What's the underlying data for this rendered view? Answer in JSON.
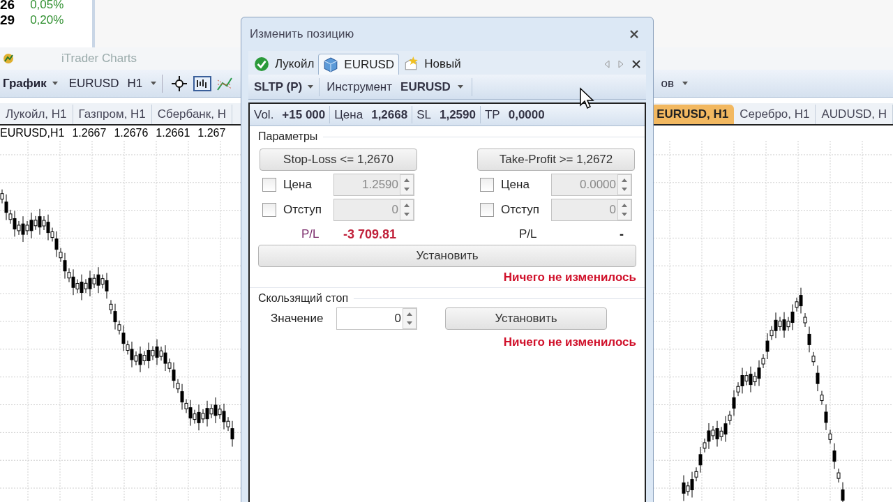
{
  "app": {
    "title": "iTrader Charts",
    "quotes": [
      {
        "price": "26",
        "change": "0,05%"
      },
      {
        "price": "29",
        "change": "0,20%"
      }
    ],
    "toolbar": {
      "chart_menu": "График",
      "symbol": "EURUSD",
      "timeframe": "H1",
      "overflow_label": "ов"
    },
    "chart_tabs_left": [
      {
        "label": "Лукойл, H1",
        "selected": false
      },
      {
        "label": "Газпром, H1",
        "selected": false
      },
      {
        "label": "Сбербанк, H",
        "selected": false
      }
    ],
    "chart_tabs_right": [
      {
        "label": "EURUSD, H1",
        "selected": true
      },
      {
        "label": "Серебро, H1",
        "selected": false
      },
      {
        "label": "AUDUSD, H",
        "selected": false
      }
    ],
    "chart_header": {
      "symbol": "EURUSD,H1",
      "values": [
        "1.2667",
        "1.2676",
        "1.2661",
        "1.267"
      ]
    }
  },
  "dialog": {
    "title": "Изменить позицию",
    "tabs": [
      {
        "label": "Лукойл",
        "selected": false
      },
      {
        "label": "EURUSD",
        "selected": true
      },
      {
        "label": "Новый",
        "selected": false
      }
    ],
    "toolbar": {
      "mode": "SLTP (P)",
      "instrument_label": "Инструмент",
      "instrument": "EURUSD"
    },
    "info": [
      {
        "label": "Vol.",
        "value": "+15 000"
      },
      {
        "label": "Цена",
        "value": "1,2668"
      },
      {
        "label": "SL",
        "value": "1,2590"
      },
      {
        "label": "TP",
        "value": "0,0000"
      }
    ],
    "params": {
      "title": "Параметры",
      "columns": [
        {
          "button": "Stop-Loss <= 1,2670",
          "rows": [
            {
              "label": "Цена",
              "checked": false,
              "value": "1.2590",
              "disabled": true
            },
            {
              "label": "Отступ",
              "checked": false,
              "value": "0",
              "disabled": true
            }
          ],
          "pl_label": "P/L",
          "pl_value": "-3 709.81",
          "pl_negative": true
        },
        {
          "button": "Take-Profit >= 1,2672",
          "rows": [
            {
              "label": "Цена",
              "checked": false,
              "value": "0.0000",
              "disabled": true
            },
            {
              "label": "Отступ",
              "checked": false,
              "value": "0",
              "disabled": true
            }
          ],
          "pl_label": "P/L",
          "pl_value": "-",
          "pl_negative": false
        }
      ],
      "apply": "Установить",
      "status": "Ничего не изменилось"
    },
    "trailing": {
      "title": "Скользящий стоп",
      "label": "Значение",
      "value": "0",
      "apply": "Установить",
      "status": "Ничего не изменилось"
    }
  }
}
